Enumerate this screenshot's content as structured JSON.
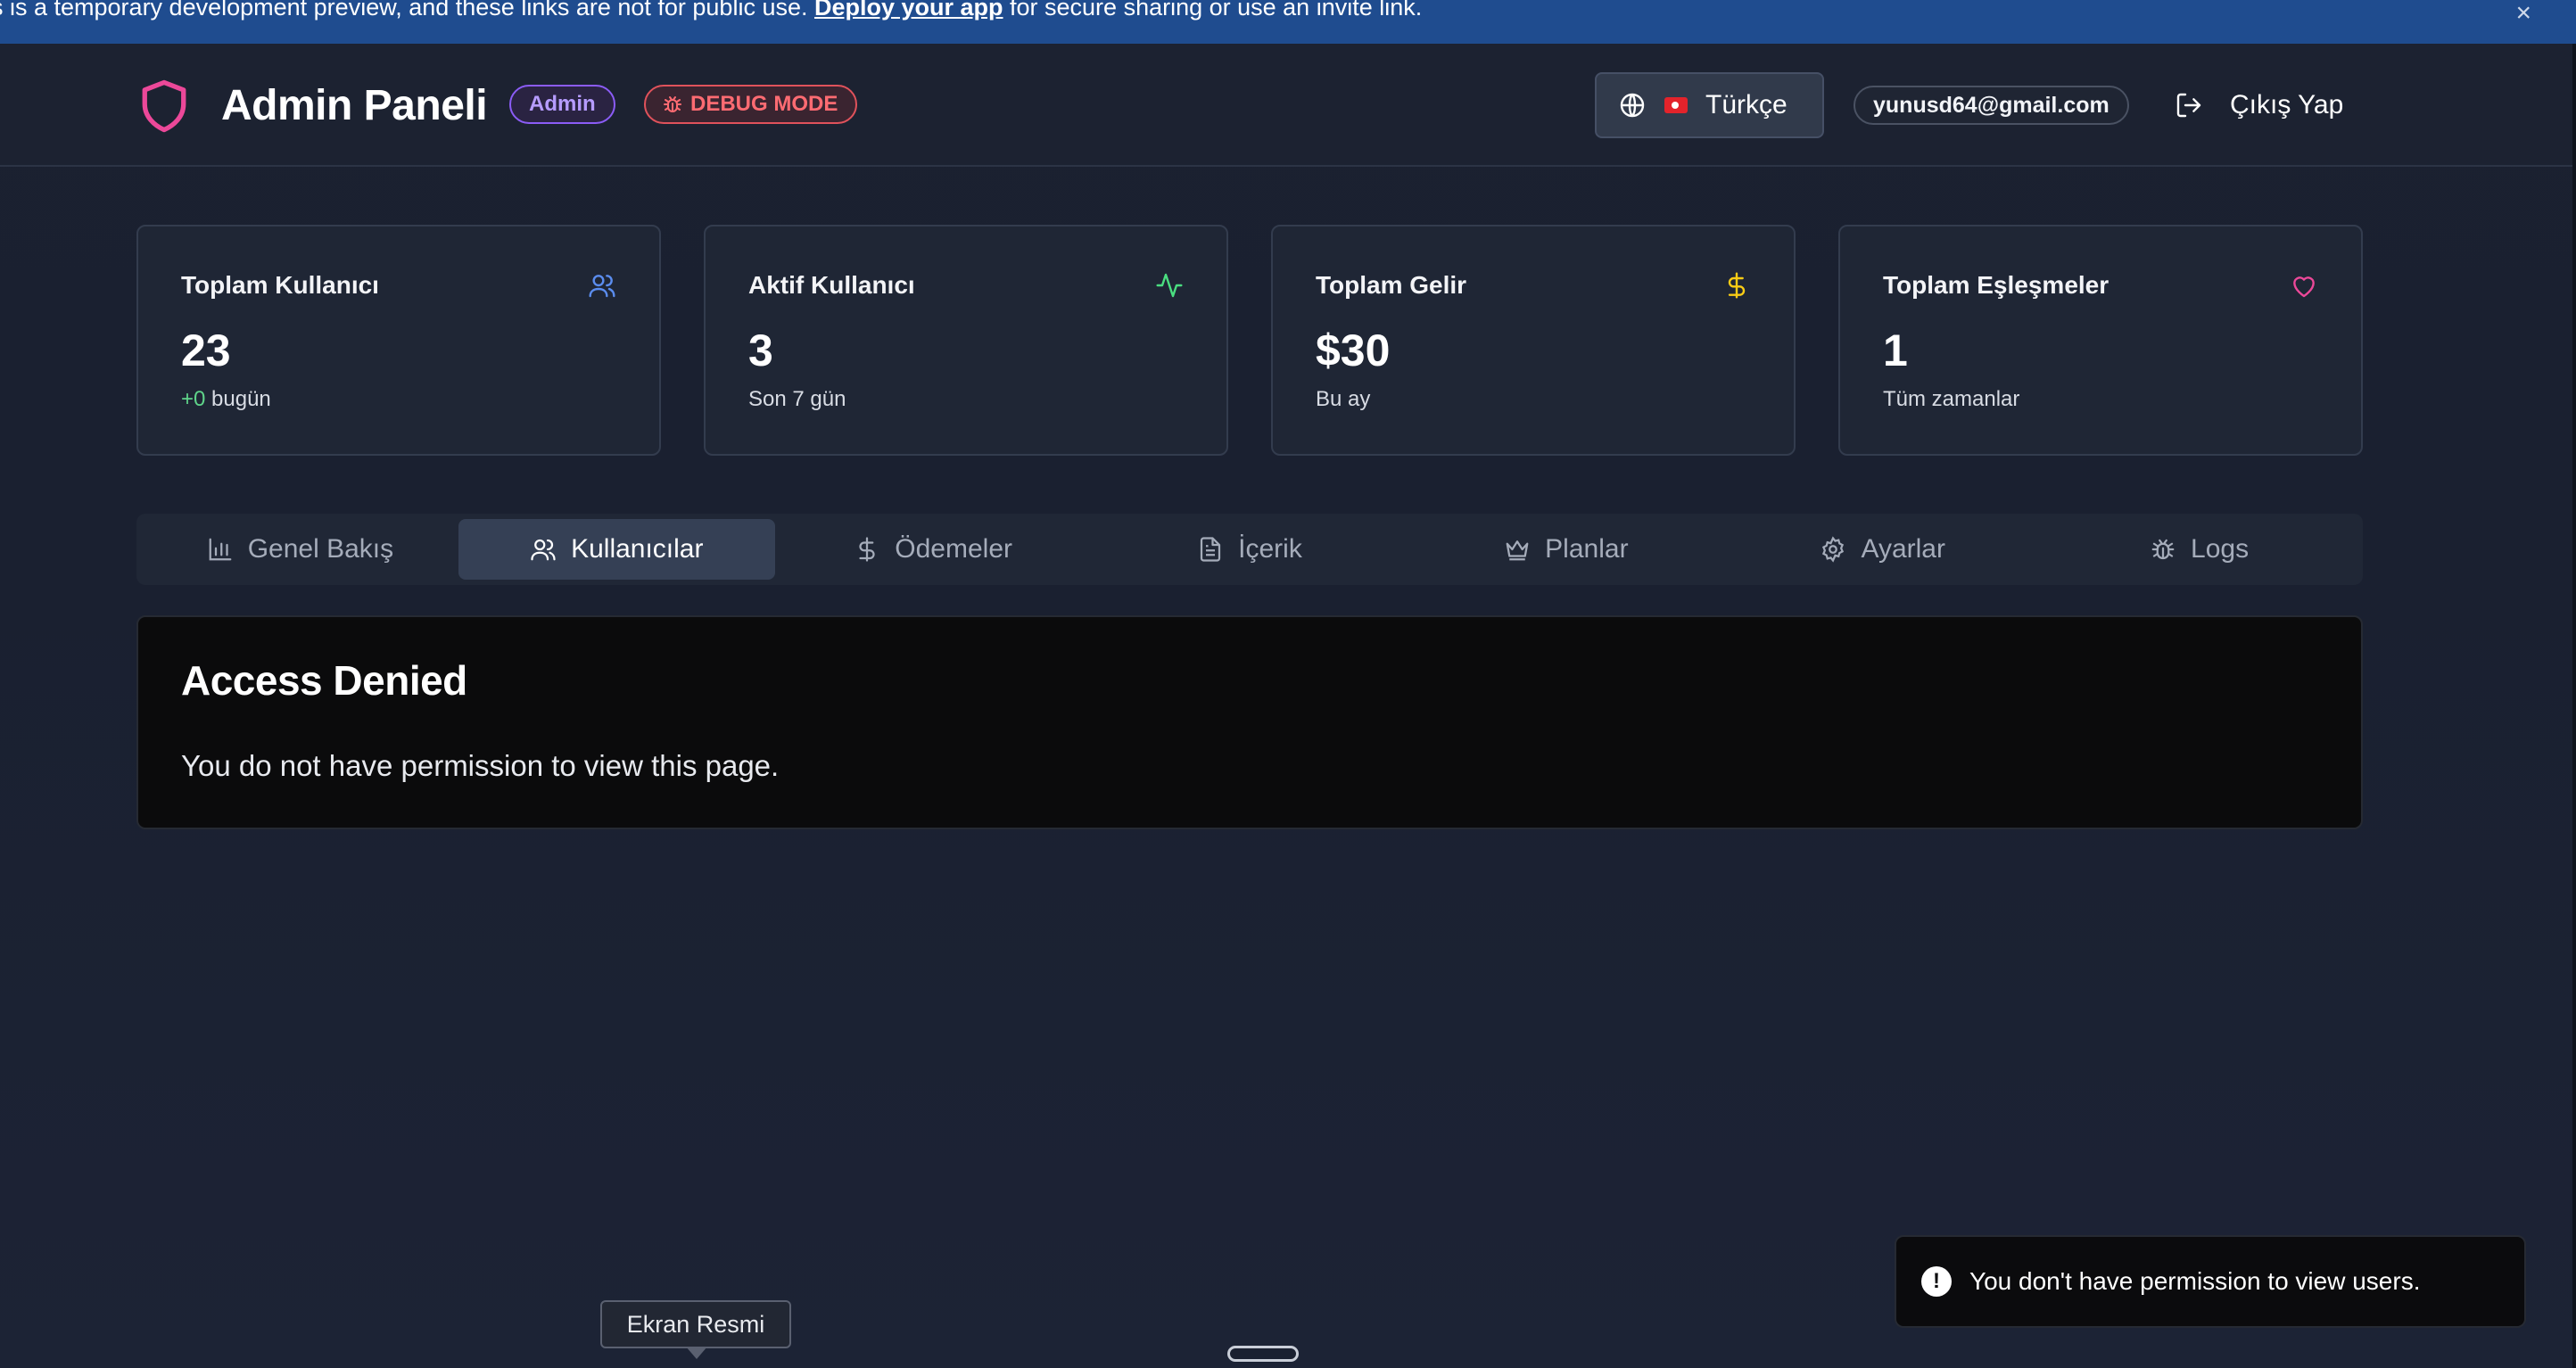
{
  "banner": {
    "text_before": "s is a temporary development preview, and these links are not for public use. ",
    "link": "Deploy your app",
    "text_after": " for secure sharing or use an invite link.",
    "close": "×"
  },
  "header": {
    "title": "Admin Paneli",
    "admin_badge": "Admin",
    "debug_badge": "DEBUG MODE",
    "language": "Türkçe",
    "email": "yunusd64@gmail.com",
    "logout": "Çıkış Yap"
  },
  "stats": [
    {
      "title": "Toplam Kullanıcı",
      "value": "23",
      "sub_highlight": "+0",
      "sub": " bugün",
      "icon": "users-icon",
      "icon_color": "#5b8def"
    },
    {
      "title": "Aktif Kullanıcı",
      "value": "3",
      "sub": "Son 7 gün",
      "icon": "activity-icon",
      "icon_color": "#4ade80"
    },
    {
      "title": "Toplam Gelir",
      "value": "$30",
      "sub": "Bu ay",
      "icon": "dollar-icon",
      "icon_color": "#facc15"
    },
    {
      "title": "Toplam Eşleşmeler",
      "value": "1",
      "sub": "Tüm zamanlar",
      "icon": "heart-icon",
      "icon_color": "#ec4899"
    }
  ],
  "tabs": [
    {
      "label": "Genel Bakış",
      "icon": "bar-chart-icon"
    },
    {
      "label": "Kullanıcılar",
      "icon": "users-icon",
      "active": true
    },
    {
      "label": "Ödemeler",
      "icon": "dollar-icon"
    },
    {
      "label": "İçerik",
      "icon": "file-text-icon"
    },
    {
      "label": "Planlar",
      "icon": "crown-icon"
    },
    {
      "label": "Ayarlar",
      "icon": "gear-icon"
    },
    {
      "label": "Logs",
      "icon": "bug-icon"
    }
  ],
  "access_denied": {
    "title": "Access Denied",
    "message": "You do not have permission to view this page."
  },
  "toast": {
    "message": "You don't have permission to view users.",
    "icon": "alert-icon"
  },
  "tooltip": {
    "text": "Ekran Resmi"
  },
  "colors": {
    "accent_pink": "#ec4899",
    "admin_purple": "#8b5cf6",
    "debug_red": "#e0525b",
    "banner_blue": "#1f4c8f"
  }
}
